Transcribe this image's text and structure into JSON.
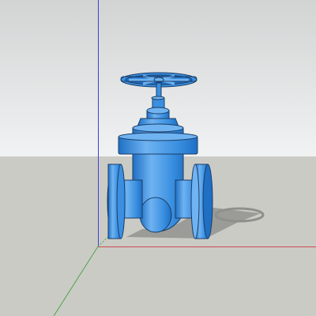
{
  "viewport": {
    "object": "gate-valve",
    "colors": {
      "sky_top": "#d2d4d4",
      "sky_bottom": "#f1f2f3",
      "ground": "#cbcbc6",
      "valve_fill": "#3a8fe0",
      "valve_light": "#6fb3f2",
      "valve_dark": "#1f6fc4",
      "outline": "#1b3e66",
      "shadow": "#8f8f8b",
      "axis_red": "#cc4b4b",
      "axis_green": "#4aa64a",
      "axis_blue": "#3e3ed6"
    }
  }
}
